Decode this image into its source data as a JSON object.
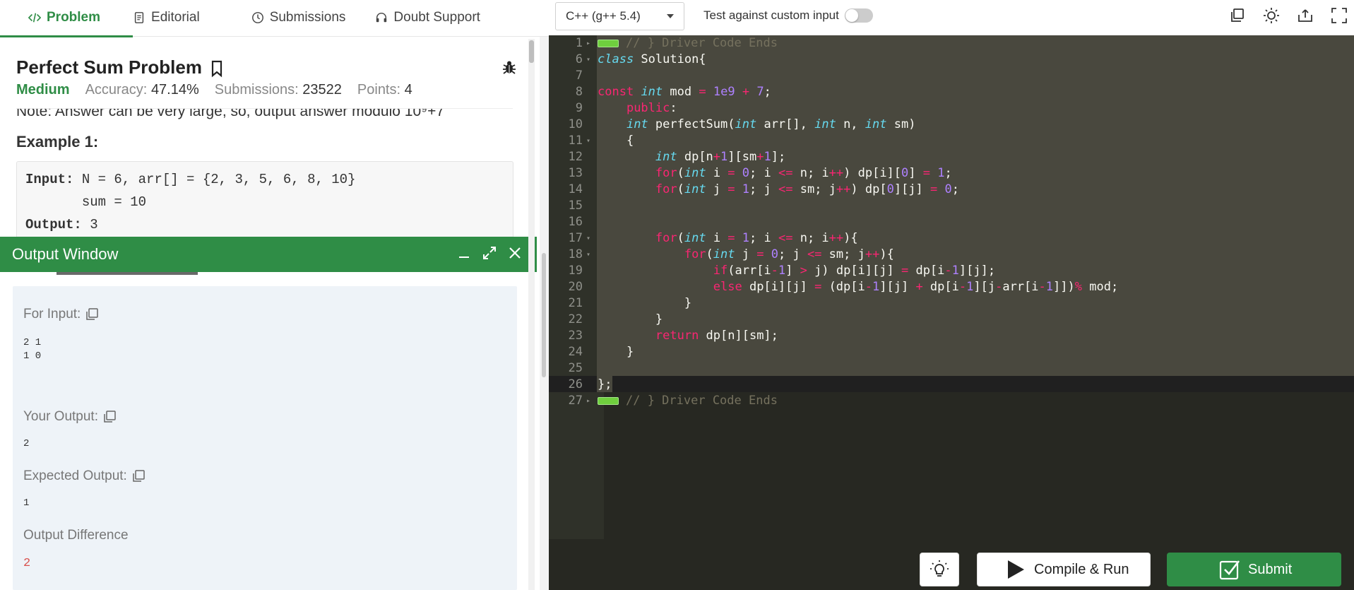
{
  "tabs": [
    {
      "label": "Problem",
      "icon": "code-icon"
    },
    {
      "label": "Editorial",
      "icon": "document-icon"
    },
    {
      "label": "Submissions",
      "icon": "clock-icon"
    },
    {
      "label": "Doubt Support",
      "icon": "headset-icon"
    }
  ],
  "problem": {
    "title": "Perfect Sum Problem",
    "difficulty": "Medium",
    "accuracy_label": "Accuracy:",
    "accuracy": "47.14%",
    "submissions_label": "Submissions:",
    "submissions": "23522",
    "points_label": "Points:",
    "points": "4",
    "note": "Note: Answer can be very large, so, output answer modulo 10⁹+7",
    "example_title": "Example 1:",
    "example": {
      "input_label": "Input:",
      "input_line1": " N = 6, arr[] = {2, 3, 5, 6, 8, 10}",
      "input_line2": "       sum = 10",
      "output_label": "Output:",
      "output_value": " 3"
    }
  },
  "output_window": {
    "title": "Output Window",
    "for_input_label": "For Input:",
    "for_input_value": "2 1\n1 0",
    "your_output_label": "Your Output:",
    "your_output_value": "2",
    "expected_output_label": "Expected Output:",
    "expected_output_value": "1",
    "difference_label": "Output Difference",
    "difference_value": "2"
  },
  "toolbar": {
    "language": "C++ (g++ 5.4)",
    "custom_input_label": "Test against custom input",
    "custom_input_enabled": false
  },
  "editor": {
    "line_numbers": [
      "1",
      "6",
      "7",
      "8",
      "9",
      "10",
      "11",
      "12",
      "13",
      "14",
      "15",
      "16",
      "17",
      "18",
      "19",
      "20",
      "21",
      "22",
      "23",
      "24",
      "25",
      "26",
      "27"
    ],
    "folded_comment_top": "// } Driver Code Ends",
    "folded_comment_bottom": "// } Driver Code Ends"
  },
  "buttons": {
    "compile_run": "Compile & Run",
    "submit": "Submit"
  },
  "colors": {
    "brand_green": "#2f8d46",
    "editor_bg": "#272822",
    "difference_red": "#d9534f"
  }
}
